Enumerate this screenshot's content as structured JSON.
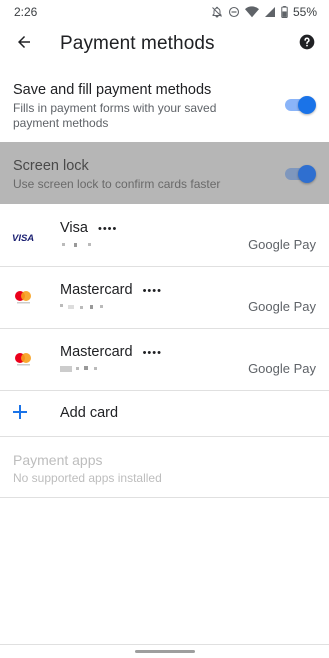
{
  "status_bar": {
    "time": "2:26",
    "battery": "55%",
    "icons": [
      "notifications-off-icon",
      "do-not-disturb-icon",
      "wifi-icon",
      "cellular-icon",
      "battery-icon"
    ]
  },
  "app_bar": {
    "back_icon": "arrow-back-icon",
    "title": "Payment methods",
    "help_icon": "help-icon"
  },
  "settings": {
    "save_fill": {
      "title": "Save and fill payment methods",
      "subtitle": "Fills in payment forms with your saved payment methods",
      "enabled": true
    },
    "screen_lock": {
      "title": "Screen lock",
      "subtitle": "Use screen lock to confirm cards faster",
      "enabled": true
    }
  },
  "cards": [
    {
      "brand": "Visa",
      "logo": "visa-logo",
      "number_masked": "••••",
      "provider": "Google Pay"
    },
    {
      "brand": "Mastercard",
      "logo": "mastercard-logo",
      "number_masked": "••••",
      "provider": "Google Pay"
    },
    {
      "brand": "Mastercard",
      "logo": "mastercard-logo",
      "number_masked": "••••",
      "provider": "Google Pay"
    }
  ],
  "add_card": {
    "icon": "plus-icon",
    "label": "Add card"
  },
  "payment_apps": {
    "title": "Payment apps",
    "subtitle": "No supported apps installed"
  },
  "colors": {
    "accent": "#1a73e8",
    "highlight_row": "#b6b6b6",
    "mastercard_red": "#eb001b",
    "mastercard_orange": "#f79e1b",
    "visa_blue": "#1a1f71"
  }
}
